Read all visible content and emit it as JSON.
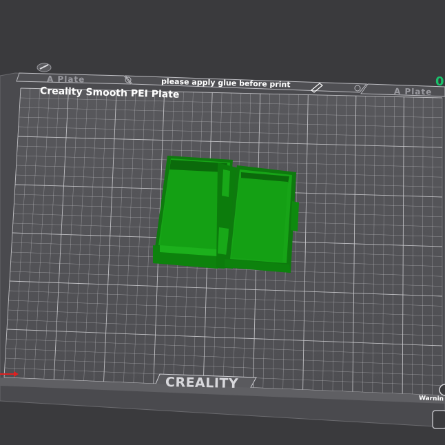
{
  "viewport": {
    "plate_left_label": "A Plate",
    "plate_right_label": "A Plate",
    "glue_notice": "please apply glue before print",
    "plate_type": "Creality Smooth PEI Plate",
    "brand": "CREALITY",
    "warning": "Warnin",
    "plate_counter": "0"
  },
  "colors": {
    "background": "#3a3a3d",
    "bed_surface": "#545458",
    "grid_line": "#d2d2d6",
    "model_green": "#129a12",
    "counter_green": "#19c26b",
    "x_axis": "#e02020"
  },
  "icons": [
    "plate-edit-icon",
    "pencil-icon",
    "settings-icon"
  ]
}
